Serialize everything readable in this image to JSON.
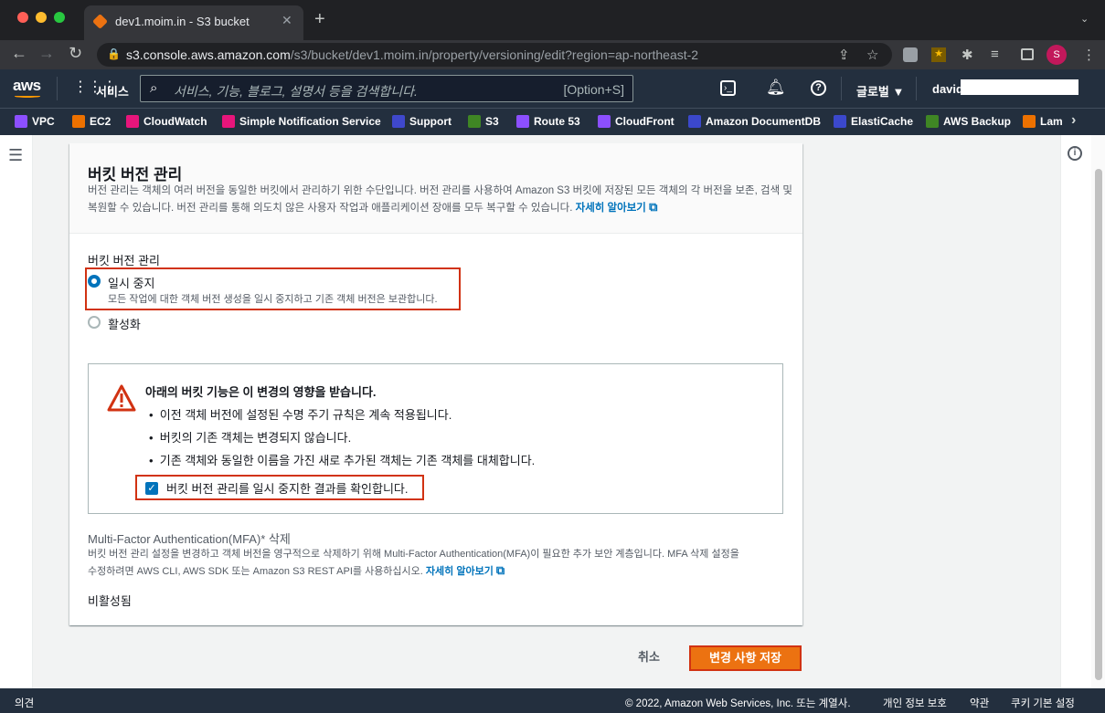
{
  "browser": {
    "tab_title": "dev1.moim.in - S3 bucket",
    "url_host": "s3.console.aws.amazon.com",
    "url_path": "/s3/bucket/dev1.moim.in/property/versioning/edit?region=ap-northeast-2",
    "profile_initial": "S"
  },
  "nav": {
    "logo": "aws",
    "services_label": "서비스",
    "search_placeholder": "서비스, 기능, 블로그, 설명서 등을 검색합니다.",
    "search_shortcut": "[Option+S]",
    "region_label": "글로벌",
    "user_label": "david"
  },
  "favorites": [
    {
      "label": "VPC",
      "color": "#8c4fff"
    },
    {
      "label": "EC2",
      "color": "#ed7100"
    },
    {
      "label": "CloudWatch",
      "color": "#e7157b"
    },
    {
      "label": "Simple Notification Service",
      "color": "#e7157b"
    },
    {
      "label": "Support",
      "color": "#3f48cc"
    },
    {
      "label": "S3",
      "color": "#3f8624"
    },
    {
      "label": "Route 53",
      "color": "#8c4fff"
    },
    {
      "label": "CloudFront",
      "color": "#8c4fff"
    },
    {
      "label": "Amazon DocumentDB",
      "color": "#3b48cc"
    },
    {
      "label": "ElastiCache",
      "color": "#3b48cc"
    },
    {
      "label": "AWS Backup",
      "color": "#3f8624"
    },
    {
      "label": "Lam",
      "color": "#ed7100"
    }
  ],
  "panel": {
    "title": "버킷 버전 관리",
    "description_line1": "버전 관리는 객체의 여러 버전을 동일한 버킷에서 관리하기 위한 수단입니다. 버전 관리를 사용하여 Amazon S3 버킷에 저장된 모든 객체의 각 버전을 보존, 검색 및",
    "description_line2": "복원할 수 있습니다. 버전 관리를 통해 의도치 않은 사용자 작업과 애플리케이션 장애를 모두 복구할 수 있습니다.",
    "learn_more": "자세히 알아보기",
    "field_label": "버킷 버전 관리",
    "option_suspend": "일시 중지",
    "option_suspend_desc": "모든 작업에 대한 객체 버전 생성을 일시 중지하고 기존 객체 버전은 보관합니다.",
    "option_enable": "활성화",
    "selected_option": "일시 중지"
  },
  "warning": {
    "title": "아래의 버킷 기능은 이 변경의 영향을 받습니다.",
    "items": [
      "이전 객체 버전에 설정된 수명 주기 규칙은 계속 적용됩니다.",
      "버킷의 기존 객체는 변경되지 않습니다.",
      "기존 객체와 동일한 이름을 가진 새로 추가된 객체는 기존 객체를 대체합니다."
    ],
    "confirm_label": "버킷 버전 관리를 일시 중지한 결과를 확인합니다.",
    "confirm_checked": true
  },
  "mfa": {
    "title": "Multi-Factor Authentication(MFA)* 삭제",
    "description_line1": "버킷 버전 관리 설정을 변경하고 객체 버전을 영구적으로 삭제하기 위해 Multi-Factor Authentication(MFA)이 필요한 추가 보안 계층입니다. MFA 삭제 설정을",
    "description_line2": "수정하려면 AWS CLI, AWS SDK 또는 Amazon S3 REST API를 사용하십시오.",
    "learn_more": "자세히 알아보기",
    "status": "비활성됨"
  },
  "actions": {
    "cancel": "취소",
    "save": "변경 사항 저장"
  },
  "footer": {
    "feedback": "의견",
    "copyright": "© 2022, Amazon Web Services, Inc. 또는 계열사.",
    "privacy": "개인 정보 보호",
    "terms": "약관",
    "cookies": "쿠키 기본 설정"
  }
}
